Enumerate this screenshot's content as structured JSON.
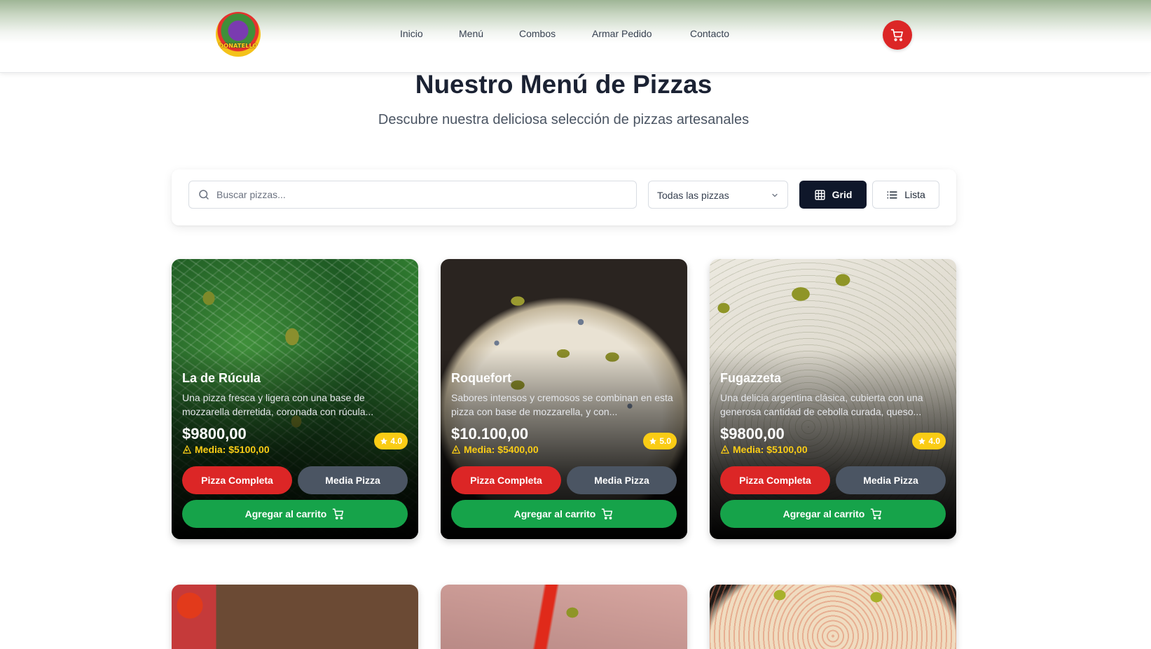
{
  "header": {
    "logo_text": "DONATELLO",
    "nav": [
      "Inicio",
      "Menú",
      "Combos",
      "Armar Pedido",
      "Contacto"
    ]
  },
  "hero": {
    "title": "Nuestro Menú de Pizzas",
    "subtitle": "Descubre nuestra deliciosa selección de pizzas artesanales"
  },
  "filters": {
    "search_placeholder": "Buscar pizzas...",
    "category_selected": "Todas las pizzas",
    "view_grid": "Grid",
    "view_list": "Lista",
    "active_view": "Grid"
  },
  "pizzas": [
    {
      "name": "La de Rúcula",
      "description": "Una pizza fresca y ligera con una base de mozzarella derretida, coronada con rúcula...",
      "price": "$9800,00",
      "half_price": "Media: $5100,00",
      "rating": "4.0"
    },
    {
      "name": "Roquefort",
      "description": "Sabores intensos y cremosos se combinan en esta pizza con base de mozzarella, y con...",
      "price": "$10.100,00",
      "half_price": "Media: $5400,00",
      "rating": "5.0"
    },
    {
      "name": "Fugazzeta",
      "description": "Una delicia argentina clásica, cubierta con una generosa cantidad de cebolla curada, queso...",
      "price": "$9800,00",
      "half_price": "Media: $5100,00",
      "rating": "4.0"
    }
  ],
  "card_buttons": {
    "full": "Pizza Completa",
    "half": "Media Pizza",
    "add_to_cart": "Agregar al carrito"
  },
  "colors": {
    "primary_red": "#dc2626",
    "cart_green": "#16a34a",
    "dark_button": "#0f172a",
    "rating_yellow": "#facc15"
  },
  "icons": [
    "shopping-cart-icon",
    "search-icon",
    "chevron-down-icon",
    "grid-icon",
    "list-icon",
    "star-icon",
    "pizza-slice-icon"
  ]
}
